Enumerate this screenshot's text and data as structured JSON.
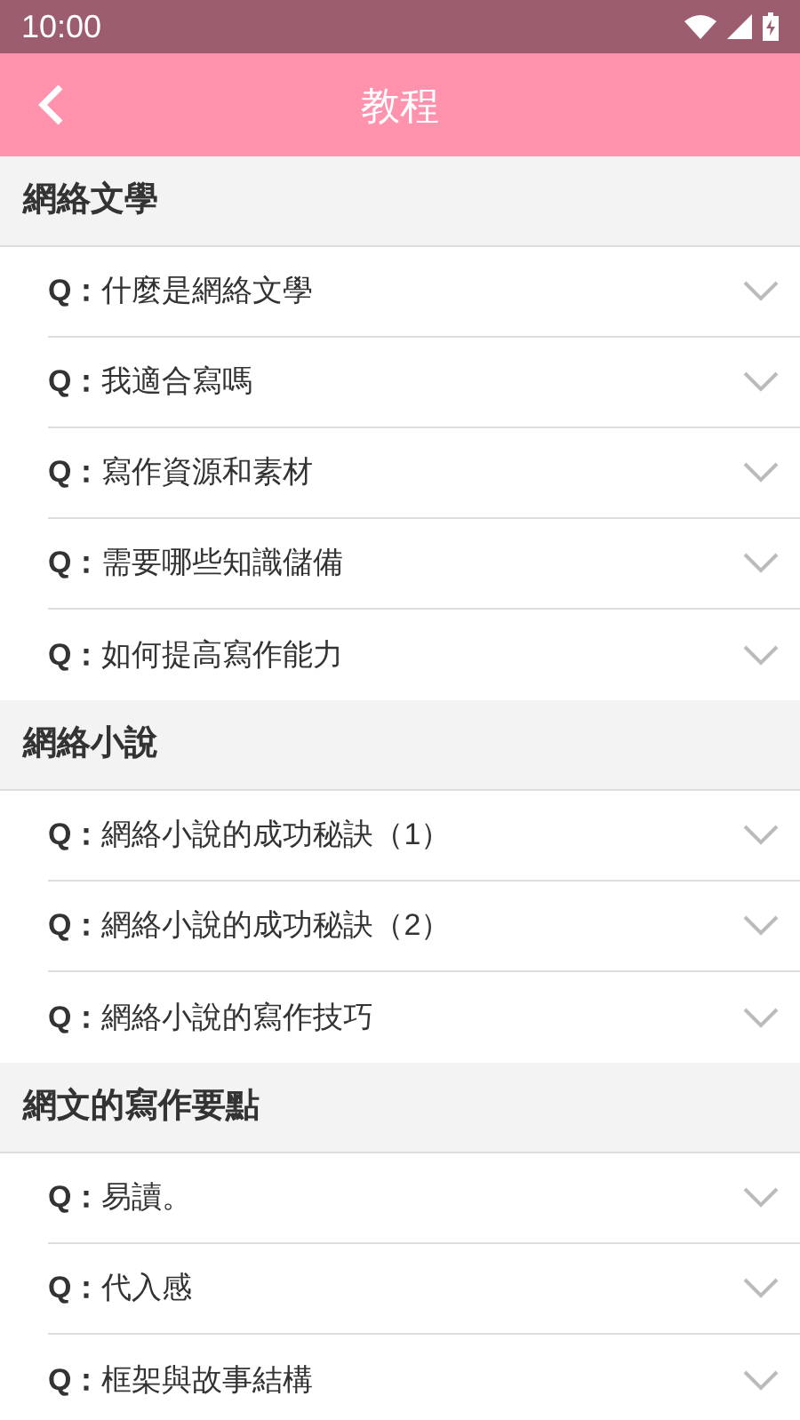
{
  "status_bar": {
    "time": "10:00"
  },
  "header": {
    "title": "教程"
  },
  "sections": [
    {
      "title": "網絡文學",
      "questions": [
        {
          "text": "**Q：**什麼是網絡文學",
          "expanded": false
        },
        {
          "text": "**Q：**我適合寫嗎",
          "expanded": false
        },
        {
          "text": "**Q：**寫作資源和素材",
          "expanded": false
        },
        {
          "text": "**Q：**需要哪些知識儲備",
          "expanded": false
        },
        {
          "text": "**Q：**如何提高寫作能力",
          "expanded": false
        }
      ]
    },
    {
      "title": "網絡小說",
      "questions": [
        {
          "text": "**Q：**網絡小說的成功秘訣（1）",
          "expanded": false
        },
        {
          "text": "**Q：**網絡小說的成功秘訣（2）",
          "expanded": false
        },
        {
          "text": "**Q：**網絡小說的寫作技巧",
          "expanded": false
        }
      ]
    },
    {
      "title": "網文的寫作要點",
      "questions": [
        {
          "text": "**Q：**易讀。",
          "expanded": false
        },
        {
          "text": "**Q：**代入感",
          "expanded": false
        },
        {
          "text": "**Q：**框架與故事結構",
          "expanded": false
        }
      ]
    }
  ]
}
